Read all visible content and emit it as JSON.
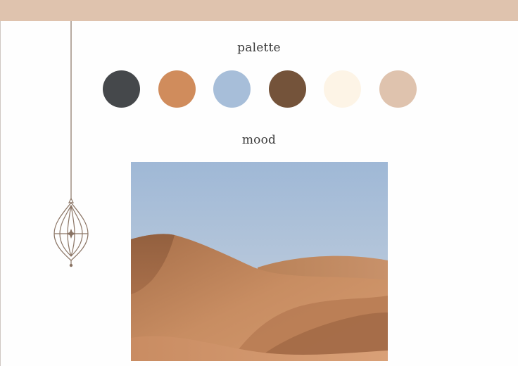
{
  "colors": {
    "top_band": "#dfc3ae",
    "lantern_stroke": "#8a7464"
  },
  "palette": {
    "heading": "palette",
    "swatches": [
      {
        "name": "charcoal",
        "color": "#45484b"
      },
      {
        "name": "terracotta",
        "color": "#d08c5c"
      },
      {
        "name": "dusty-blue",
        "color": "#a7bed9"
      },
      {
        "name": "walnut-brown",
        "color": "#74533a"
      },
      {
        "name": "cream",
        "color": "#fdf4e6"
      },
      {
        "name": "nude-beige",
        "color": "#dfc3ae"
      }
    ]
  },
  "mood": {
    "heading": "mood",
    "image_subject": "desert-sand-dunes-photo"
  },
  "decor": {
    "icon": "hanging-lantern-icon"
  }
}
